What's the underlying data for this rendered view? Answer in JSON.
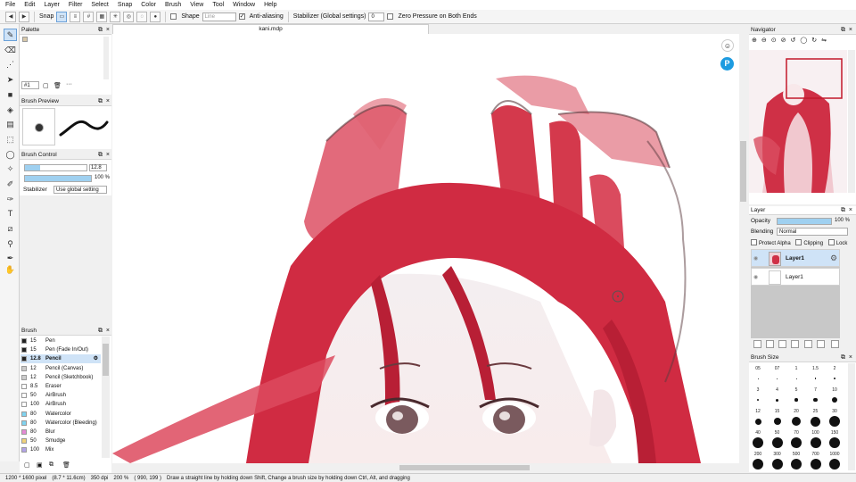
{
  "menu": [
    "File",
    "Edit",
    "Layer",
    "Filter",
    "Select",
    "Snap",
    "Color",
    "Brush",
    "View",
    "Tool",
    "Window",
    "Help"
  ],
  "toolbar": {
    "snap_label": "Snap",
    "shape_label": "Shape",
    "shape_value": "Line",
    "antialias_label": "Anti-aliasing",
    "stabilizer_label": "Stabilizer (Global settings)",
    "stabilizer_value": "0",
    "zero_pressure_label": "Zero Pressure on Both Ends"
  },
  "document": {
    "tab_title": "kani.mdp"
  },
  "palette": {
    "title": "Palette",
    "set_value": "#1"
  },
  "brush_preview": {
    "title": "Brush Preview"
  },
  "brush_control": {
    "title": "Brush Control",
    "size_value": "12.8",
    "opacity_value": "100 %",
    "stabilizer_label": "Stabilizer",
    "stabilizer_value": "Use global setting"
  },
  "brush_list": {
    "title": "Brush",
    "items": [
      {
        "size": "15",
        "name": "Pen",
        "color": "#222222"
      },
      {
        "size": "15",
        "name": "Pen (Fade In/Out)",
        "color": "#222222"
      },
      {
        "size": "12.8",
        "name": "Pencil",
        "color": "#222222",
        "selected": true
      },
      {
        "size": "12",
        "name": "Pencil (Canvas)",
        "color": "#cccccc"
      },
      {
        "size": "12",
        "name": "Pencil (Sketchbook)",
        "color": "#cccccc"
      },
      {
        "size": "8.5",
        "name": "Eraser",
        "color": "#ffffff"
      },
      {
        "size": "50",
        "name": "AirBrush",
        "color": "#ffffff"
      },
      {
        "size": "100",
        "name": "AirBrush",
        "color": "#ffffff"
      },
      {
        "size": "80",
        "name": "Watercolor",
        "color": "#7fd3f0"
      },
      {
        "size": "80",
        "name": "Watercolor (Bleeding)",
        "color": "#7fd3f0"
      },
      {
        "size": "80",
        "name": "Blur",
        "color": "#e58ad6"
      },
      {
        "size": "50",
        "name": "Smudge",
        "color": "#f0d27a"
      },
      {
        "size": "100",
        "name": "Mix",
        "color": "#b3a3e8"
      }
    ]
  },
  "navigator": {
    "title": "Navigator"
  },
  "layer_panel": {
    "title": "Layer",
    "opacity_label": "Opacity",
    "opacity_value": "100 %",
    "opacity_fill": 1.0,
    "blending_label": "Blending",
    "blending_value": "Normal",
    "protect_alpha": "Protect Alpha",
    "clipping": "Clipping",
    "lock": "Lock",
    "layers": [
      {
        "name": "Layer1",
        "selected": true
      },
      {
        "name": "Layer1",
        "selected": false
      }
    ]
  },
  "brush_size": {
    "title": "Brush Size",
    "labels": [
      "05",
      "07",
      "1",
      "1.5",
      "2",
      "3",
      "4",
      "5",
      "7",
      "10",
      "12",
      "15",
      "20",
      "25",
      "30",
      "40",
      "50",
      "70",
      "100",
      "150",
      "200",
      "300",
      "500",
      "700",
      "1000"
    ]
  },
  "status": {
    "size": "1200 * 1600 pixel",
    "cm": "(8.7 * 11.6cm)",
    "dpi": "350 dpi",
    "zoom": "200 %",
    "coords": "( 990, 199 )",
    "hint": "Draw a straight line by holding down Shift, Change a brush size by holding down Ctrl, Alt, and dragging"
  },
  "colors": {
    "accent": "#cfe3f7",
    "hair_red": "#d8384f",
    "selection_border": "#c2182b"
  }
}
